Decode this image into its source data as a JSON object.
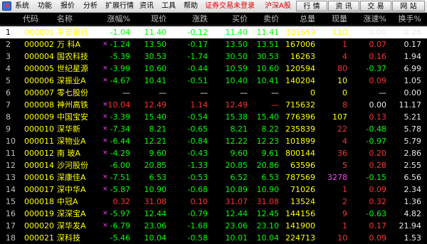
{
  "menu": {
    "items": [
      "系统",
      "功能",
      "报价",
      "分析",
      "扩展行情",
      "资讯",
      "工具",
      "帮助"
    ],
    "status_red": [
      "证券交易未登录",
      "沪深A股"
    ],
    "right_buttons": [
      "行 情",
      "资 讯",
      "交 易",
      "网 站"
    ]
  },
  "columns": [
    "代码",
    "名称",
    "涨幅%",
    "现价",
    "涨跌",
    "买价",
    "卖价",
    "总量",
    "现量",
    "涨速%",
    "换手%"
  ],
  "rows": [
    {
      "idx": "1",
      "code": "000001",
      "name": "平安银行",
      "mark": "",
      "chg_pct": "-1.04",
      "price": "11.40",
      "chg": "-0.12",
      "bid": "11.40",
      "ask": "11.41",
      "vol": "301659",
      "cur": "110",
      "speed": "0.00",
      "turnover": "0.26",
      "price_color": "g",
      "cur_color": "y",
      "speed_color": "w"
    },
    {
      "idx": "2",
      "code": "000002",
      "name": "万 科A",
      "mark": "×",
      "chg_pct": "-1.24",
      "price": "13.50",
      "chg": "-0.17",
      "bid": "13.50",
      "ask": "13.51",
      "vol": "167006",
      "cur": "1",
      "speed": "0.07",
      "turnover": "0.17",
      "price_color": "g",
      "cur_color": "rd",
      "speed_color": "rd"
    },
    {
      "idx": "3",
      "code": "000004",
      "name": "国农科技",
      "mark": "",
      "chg_pct": "-5.39",
      "price": "30.53",
      "chg": "-1.74",
      "bid": "30.50",
      "ask": "30.53",
      "vol": "16263",
      "cur": "4",
      "speed": "0.16",
      "turnover": "1.94",
      "price_color": "g",
      "cur_color": "rd",
      "speed_color": "rd"
    },
    {
      "idx": "4",
      "code": "000005",
      "name": "世纪星源",
      "mark": "×",
      "chg_pct": "-3.99",
      "price": "10.60",
      "chg": "-0.44",
      "bid": "10.59",
      "ask": "10.60",
      "vol": "120594",
      "cur": "80",
      "speed": "-0.37",
      "turnover": "6.99",
      "price_color": "g",
      "cur_color": "rd",
      "speed_color": "g"
    },
    {
      "idx": "5",
      "code": "000006",
      "name": "深振业A",
      "mark": "×",
      "chg_pct": "-4.67",
      "price": "10.41",
      "chg": "-0.51",
      "bid": "10.40",
      "ask": "10.41",
      "vol": "140204",
      "cur": "10",
      "speed": "0.09",
      "turnover": "1.05",
      "price_color": "g",
      "cur_color": "y",
      "speed_color": "rd"
    },
    {
      "idx": "6",
      "code": "000007",
      "name": "零七股份",
      "mark": "",
      "chg_pct": "—",
      "price": "—",
      "chg": "—",
      "bid": "—",
      "ask": "—",
      "vol": "0",
      "cur": "0",
      "speed": "—",
      "turnover": "0.00",
      "price_color": "w",
      "cur_color": "y",
      "speed_color": "w"
    },
    {
      "idx": "7",
      "code": "000008",
      "name": "神州高铁",
      "mark": "×",
      "chg_pct": "10.04",
      "price": "12.49",
      "chg": "1.14",
      "bid": "12.49",
      "ask": "—",
      "vol": "715632",
      "cur": "8",
      "speed": "0.00",
      "turnover": "11.17",
      "price_color": "rd",
      "cur_color": "rd",
      "speed_color": "w"
    },
    {
      "idx": "8",
      "code": "000009",
      "name": "中国宝安",
      "mark": "×",
      "chg_pct": "-3.39",
      "price": "15.40",
      "chg": "-0.54",
      "bid": "15.38",
      "ask": "15.40",
      "vol": "776396",
      "cur": "107",
      "speed": "0.13",
      "turnover": "5.21",
      "price_color": "g",
      "cur_color": "y",
      "speed_color": "rd"
    },
    {
      "idx": "9",
      "code": "000010",
      "name": "深华新",
      "mark": "×",
      "chg_pct": "-7.34",
      "price": "8.21",
      "chg": "-0.65",
      "bid": "8.21",
      "ask": "8.22",
      "vol": "235839",
      "cur": "22",
      "speed": "-0.48",
      "turnover": "5.78",
      "price_color": "g",
      "cur_color": "rd",
      "speed_color": "g"
    },
    {
      "idx": "10",
      "code": "000011",
      "name": "深物业A",
      "mark": "×",
      "chg_pct": "-6.44",
      "price": "12.21",
      "chg": "-0.84",
      "bid": "12.22",
      "ask": "12.23",
      "vol": "101899",
      "cur": "4",
      "speed": "-0.97",
      "turnover": "5.79",
      "price_color": "g",
      "cur_color": "rd",
      "speed_color": "g"
    },
    {
      "idx": "11",
      "code": "000012",
      "name": "南 玻A",
      "mark": "×",
      "chg_pct": "-4.29",
      "price": "9.60",
      "chg": "-0.43",
      "bid": "9.60",
      "ask": "9.61",
      "vol": "800144",
      "cur": "36",
      "speed": "0.20",
      "turnover": "2.86",
      "price_color": "g",
      "cur_color": "rd",
      "speed_color": "rd"
    },
    {
      "idx": "12",
      "code": "000014",
      "name": "沙河股份",
      "mark": "",
      "chg_pct": "-6.00",
      "price": "20.85",
      "chg": "-1.33",
      "bid": "20.85",
      "ask": "20.86",
      "vol": "63596",
      "cur": "5",
      "speed": "0.28",
      "turnover": "2.55",
      "price_color": "g",
      "cur_color": "rd",
      "speed_color": "rd"
    },
    {
      "idx": "13",
      "code": "000016",
      "name": "深康佳A",
      "mark": "×",
      "chg_pct": "-7.51",
      "price": "6.53",
      "chg": "-0.53",
      "bid": "6.52",
      "ask": "6.53",
      "vol": "787569",
      "cur": "3278",
      "speed": "-0.15",
      "turnover": "6.56",
      "price_color": "g",
      "cur_color": "m",
      "speed_color": "g"
    },
    {
      "idx": "14",
      "code": "000017",
      "name": "深中华A",
      "mark": "×",
      "chg_pct": "-5.87",
      "price": "10.90",
      "chg": "-0.68",
      "bid": "10.89",
      "ask": "10.90",
      "vol": "71026",
      "cur": "1",
      "speed": "0.09",
      "turnover": "2.34",
      "price_color": "g",
      "cur_color": "rd",
      "speed_color": "rd"
    },
    {
      "idx": "15",
      "code": "000018",
      "name": "中冠A",
      "mark": "",
      "chg_pct": "0.32",
      "price": "31.08",
      "chg": "0.10",
      "bid": "31.07",
      "ask": "31.08",
      "vol": "13524",
      "cur": "2",
      "speed": "0.32",
      "turnover": "1.36",
      "price_color": "rd",
      "cur_color": "rd",
      "speed_color": "rd"
    },
    {
      "idx": "16",
      "code": "000019",
      "name": "深深宝A",
      "mark": "×",
      "chg_pct": "-5.97",
      "price": "12.44",
      "chg": "-0.79",
      "bid": "12.44",
      "ask": "12.45",
      "vol": "144156",
      "cur": "9",
      "speed": "-0.63",
      "turnover": "4.82",
      "price_color": "g",
      "cur_color": "rd",
      "speed_color": "g"
    },
    {
      "idx": "17",
      "code": "000020",
      "name": "深华发A",
      "mark": "×",
      "chg_pct": "-6.79",
      "price": "23.06",
      "chg": "-1.68",
      "bid": "23.06",
      "ask": "23.10",
      "vol": "141900",
      "cur": "1",
      "speed": "0.17",
      "turnover": "21.94",
      "price_color": "g",
      "cur_color": "rd",
      "speed_color": "rd"
    },
    {
      "idx": "18",
      "code": "000021",
      "name": "深科技",
      "mark": "",
      "chg_pct": "-5.46",
      "price": "10.04",
      "chg": "-0.58",
      "bid": "10.01",
      "ask": "10.04",
      "vol": "224713",
      "cur": "10",
      "speed": "0.09",
      "turnover": "1.53",
      "price_color": "g",
      "cur_color": "rd",
      "speed_color": "rd"
    }
  ],
  "colors": {
    "up": "#ff3232",
    "down": "#00ff00",
    "code": "#ffff00",
    "background": "#000000"
  }
}
